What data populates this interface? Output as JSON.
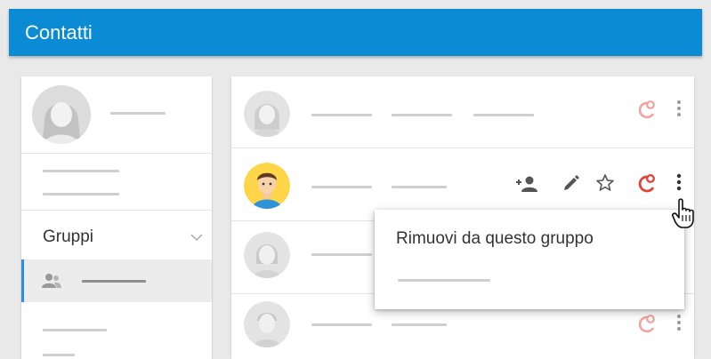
{
  "app": {
    "title": "Contatti"
  },
  "sidebar": {
    "group_label": "Gruppi"
  },
  "context_menu": {
    "items": [
      {
        "label": "Rimuovi da questo gruppo"
      }
    ]
  },
  "colors": {
    "appbar": "#0a8bd4",
    "accent": "#2b8ee0",
    "remove_icon": "#e0453a"
  },
  "icons": [
    "person-avatar-icon",
    "chevron-down-icon",
    "group-icon",
    "add-person-icon",
    "edit-icon",
    "star-icon",
    "remove-from-group-icon",
    "more-vert-icon",
    "hand-cursor-icon"
  ]
}
